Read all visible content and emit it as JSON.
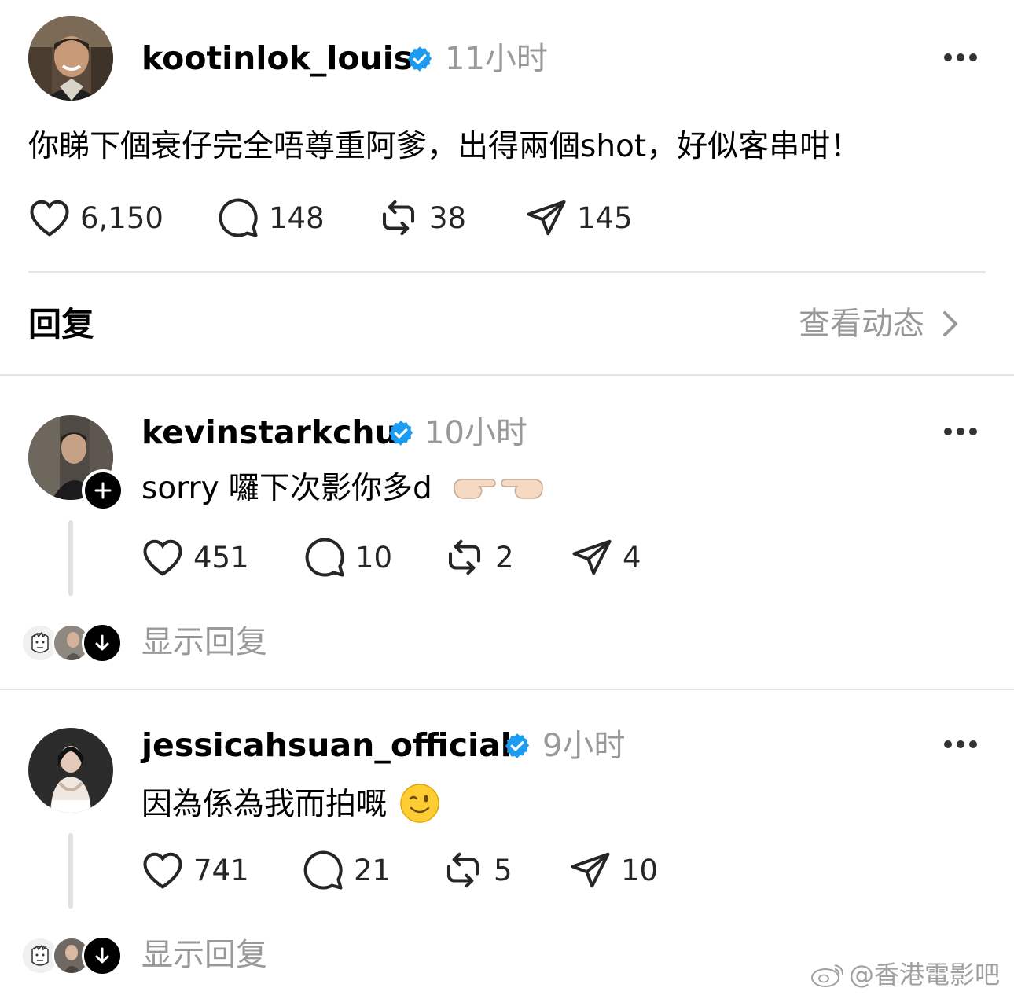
{
  "post": {
    "username": "kootinlok_louis",
    "time": "11小时",
    "text": "你睇下個衰仔完全唔尊重阿爹，出得兩個shot，好似客串咁！",
    "likes": "6,150",
    "comments": "148",
    "reposts": "38",
    "shares": "145",
    "icons": {
      "avatar": "avatar",
      "verified": "verified-badge-icon",
      "more": "more-options-icon",
      "like": "heart-icon",
      "comment": "comment-icon",
      "repost": "repost-icon",
      "share": "send-icon"
    }
  },
  "replies_header": {
    "title": "回复",
    "activity_link": "查看动态"
  },
  "replies": [
    {
      "username": "kevinstarkchu",
      "time": "10小时",
      "text": "sorry 囉下次影你多d",
      "emoji": "👉🏻👈🏻",
      "likes": "451",
      "comments": "10",
      "reposts": "2",
      "shares": "4",
      "show_replies": "显示回复"
    },
    {
      "username": "jessicahsuan_official",
      "time": "9小时",
      "text": "因為係為我而拍嘅",
      "emoji": "😉",
      "likes": "741",
      "comments": "21",
      "reposts": "5",
      "shares": "10",
      "show_replies": "显示回复"
    }
  ],
  "watermark": "@香港電影吧",
  "colors": {
    "accent": "#1d9bf0",
    "muted": "#999999",
    "divider": "#e6e6e6"
  }
}
